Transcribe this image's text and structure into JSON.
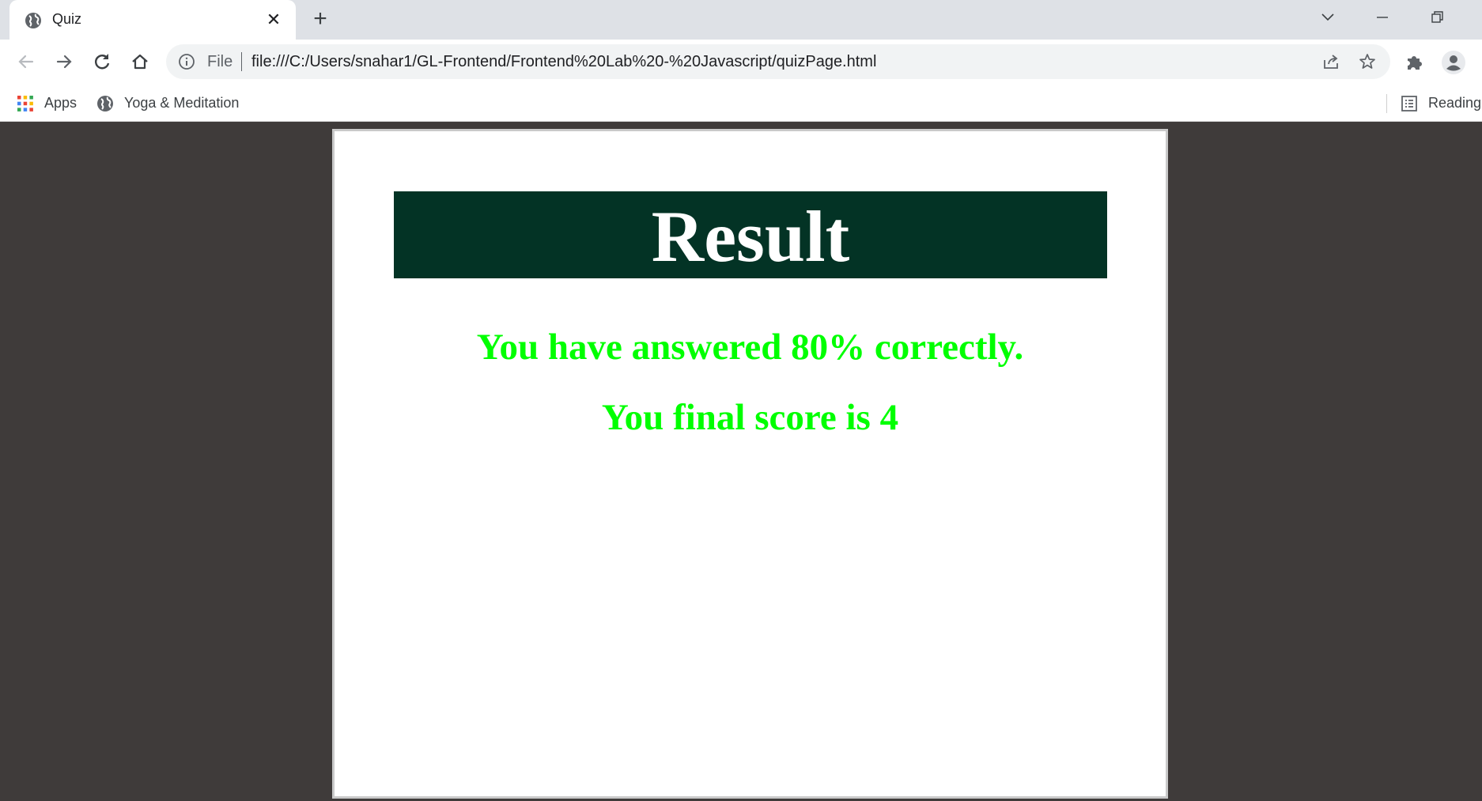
{
  "browser": {
    "tab": {
      "title": "Quiz",
      "close_glyph": "✕",
      "favicon": "globe-icon"
    },
    "new_tab_glyph": "+",
    "address_bar": {
      "scheme_label": "File",
      "url": "file:///C:/Users/snahar1/GL-Frontend/Frontend%20Lab%20-%20Javascript/quizPage.html"
    },
    "bookmarks": [
      {
        "label": "Apps",
        "icon": "apps-grid-icon"
      },
      {
        "label": "Yoga & Meditation",
        "icon": "globe-icon"
      }
    ],
    "reading_list_label": "Reading"
  },
  "page": {
    "heading": "Result",
    "percent_text": "You have answered 80% correctly.",
    "score_text": "You final score is 4",
    "colors": {
      "banner_bg": "#033325",
      "heading_text": "#ffffff",
      "result_text": "#00ff00",
      "backdrop": "#3f3b3a"
    }
  }
}
